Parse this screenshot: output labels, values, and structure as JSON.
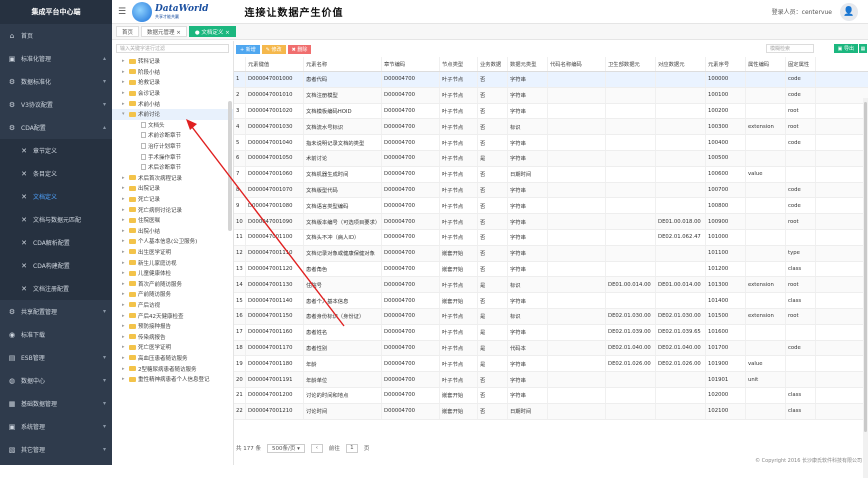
{
  "app_title": "集成平台中心端",
  "header": {
    "logo_main": "DataWorld",
    "logo_sub": "共享才能共赢",
    "slogan": "连接让数据产生价值",
    "user_label": "登录人员：centervue"
  },
  "sidebar": {
    "items": [
      {
        "label": "首页",
        "icon": "home-icon",
        "glyph": "⌂",
        "sub": false,
        "chev": ""
      },
      {
        "label": "标准化管理",
        "icon": "standard-icon",
        "glyph": "▣",
        "sub": false,
        "chev": "▴"
      },
      {
        "label": "数据标准化",
        "icon": "gear-icon",
        "glyph": "⚙",
        "sub": false,
        "chev": "▾"
      },
      {
        "label": "V3协议配置",
        "icon": "gear-icon",
        "glyph": "⚙",
        "sub": false,
        "chev": "▾"
      },
      {
        "label": "CDA配置",
        "icon": "gear-icon",
        "glyph": "⚙",
        "sub": false,
        "chev": "▴"
      },
      {
        "label": "章节定义",
        "icon": "tools-icon",
        "glyph": "✕",
        "sub": true,
        "chev": ""
      },
      {
        "label": "条目定义",
        "icon": "tools-icon",
        "glyph": "✕",
        "sub": true,
        "chev": ""
      },
      {
        "label": "文档定义",
        "icon": "tools-icon",
        "glyph": "✕",
        "sub": true,
        "chev": "",
        "active": true
      },
      {
        "label": "文档与数据元匹配",
        "icon": "tools-icon",
        "glyph": "✕",
        "sub": true,
        "chev": ""
      },
      {
        "label": "CDA解析配置",
        "icon": "tools-icon",
        "glyph": "✕",
        "sub": true,
        "chev": ""
      },
      {
        "label": "CDA构建配置",
        "icon": "tools-icon",
        "glyph": "✕",
        "sub": true,
        "chev": ""
      },
      {
        "label": "文档注册配置",
        "icon": "tools-icon",
        "glyph": "✕",
        "sub": true,
        "chev": ""
      },
      {
        "label": "共享配置管理",
        "icon": "gear-icon",
        "glyph": "⚙",
        "sub": false,
        "chev": "▾"
      },
      {
        "label": "标准下载",
        "icon": "download-icon",
        "glyph": "◉",
        "sub": false,
        "chev": ""
      },
      {
        "label": "ESB管理",
        "icon": "bus-icon",
        "glyph": "▤",
        "sub": false,
        "chev": "▾"
      },
      {
        "label": "数据中心",
        "icon": "database-icon",
        "glyph": "◍",
        "sub": false,
        "chev": "▾"
      },
      {
        "label": "基础数据管理",
        "icon": "data-icon",
        "glyph": "▦",
        "sub": false,
        "chev": "▾"
      },
      {
        "label": "系统管理",
        "icon": "system-icon",
        "glyph": "▣",
        "sub": false,
        "chev": "▾"
      },
      {
        "label": "其它管理",
        "icon": "other-icon",
        "glyph": "▧",
        "sub": false,
        "chev": "▾"
      }
    ]
  },
  "tabs": [
    {
      "label": "首页",
      "active": false
    },
    {
      "label": "数据元管理 ×",
      "active": false
    },
    {
      "label": "● 文档定义 ×",
      "active": true
    }
  ],
  "tree": {
    "search_placeholder": "输入关键字进行过滤",
    "nodes": [
      {
        "label": "转科记录",
        "depth": 1,
        "type": "folder"
      },
      {
        "label": "阶段小结",
        "depth": 1,
        "type": "folder"
      },
      {
        "label": "抢救记录",
        "depth": 1,
        "type": "folder"
      },
      {
        "label": "会诊记录",
        "depth": 1,
        "type": "folder"
      },
      {
        "label": "术前小结",
        "depth": 1,
        "type": "folder"
      },
      {
        "label": "术前讨论",
        "depth": 1,
        "type": "folder",
        "open": true
      },
      {
        "label": "文档头",
        "depth": 2,
        "type": "doc"
      },
      {
        "label": "术前诊断章节",
        "depth": 2,
        "type": "doc"
      },
      {
        "label": "治疗计划章节",
        "depth": 2,
        "type": "doc"
      },
      {
        "label": "手术操作章节",
        "depth": 2,
        "type": "doc"
      },
      {
        "label": "术后诊断章节",
        "depth": 2,
        "type": "doc"
      },
      {
        "label": "术后首次病程记录",
        "depth": 1,
        "type": "folder"
      },
      {
        "label": "出院记录",
        "depth": 1,
        "type": "folder"
      },
      {
        "label": "死亡记录",
        "depth": 1,
        "type": "folder"
      },
      {
        "label": "死亡病例讨论记录",
        "depth": 1,
        "type": "folder"
      },
      {
        "label": "住院医嘱",
        "depth": 1,
        "type": "folder"
      },
      {
        "label": "出院小结",
        "depth": 1,
        "type": "folder"
      },
      {
        "label": "个人基本信息(公卫服务)",
        "depth": 1,
        "type": "folder"
      },
      {
        "label": "出生医学证明",
        "depth": 1,
        "type": "folder"
      },
      {
        "label": "新生儿家庭访视",
        "depth": 1,
        "type": "folder"
      },
      {
        "label": "儿童健康体检",
        "depth": 1,
        "type": "folder"
      },
      {
        "label": "首次产前随访服务",
        "depth": 1,
        "type": "folder"
      },
      {
        "label": "产前随访服务",
        "depth": 1,
        "type": "folder"
      },
      {
        "label": "产后访视",
        "depth": 1,
        "type": "folder"
      },
      {
        "label": "产后42天健康检查",
        "depth": 1,
        "type": "folder"
      },
      {
        "label": "预防接种报告",
        "depth": 1,
        "type": "folder"
      },
      {
        "label": "传染病报告",
        "depth": 1,
        "type": "folder"
      },
      {
        "label": "死亡医学证明",
        "depth": 1,
        "type": "folder"
      },
      {
        "label": "高血压患者随访服务",
        "depth": 1,
        "type": "folder"
      },
      {
        "label": "2型糖尿病患者随访服务",
        "depth": 1,
        "type": "folder"
      },
      {
        "label": "重性精神病患者个人信息登记",
        "depth": 1,
        "type": "folder"
      }
    ]
  },
  "toolbar": {
    "add_label": "+ 新增",
    "edit_label": "✎ 修改",
    "delete_label": "✖ 删除",
    "search_placeholder": "模糊检索",
    "export_label": "▣ 导出"
  },
  "table": {
    "columns": [
      "",
      "元素键值",
      "元素名称",
      "章节编码",
      "节点类型",
      "业务数据",
      "数据元类型",
      "代码名称编码",
      "卫生部数据元",
      "对应数据元",
      "元素序号",
      "属性编码",
      "固定属性"
    ],
    "widths": [
      12,
      58,
      78,
      58,
      38,
      30,
      40,
      58,
      50,
      50,
      40,
      40,
      30
    ],
    "rows": [
      [
        "1",
        "D000047001000",
        "患者代码",
        "D00004700",
        "叶子节点",
        "否",
        "字符串",
        "",
        "",
        "",
        "100000",
        "",
        "code"
      ],
      [
        "2",
        "D000047001010",
        "文档注册模型",
        "D00004700",
        "叶子节点",
        "否",
        "字符串",
        "",
        "",
        "",
        "100100",
        "",
        "code"
      ],
      [
        "3",
        "D000047001020",
        "文档模板编码HOID",
        "D00004700",
        "叶子节点",
        "否",
        "字符串",
        "",
        "",
        "",
        "100200",
        "",
        "root"
      ],
      [
        "4",
        "D000047001030",
        "文档流水号标识",
        "D00004700",
        "叶子节点",
        "否",
        "标识",
        "",
        "",
        "",
        "100300",
        "extension",
        "root"
      ],
      [
        "5",
        "D000047001040",
        "指未说明记录文档的类型",
        "D00004700",
        "叶子节点",
        "否",
        "字符串",
        "",
        "",
        "",
        "100400",
        "",
        "code"
      ],
      [
        "6",
        "D000047001050",
        "术前讨论",
        "D00004700",
        "叶子节点",
        "是",
        "字符串",
        "",
        "",
        "",
        "100500",
        "",
        ""
      ],
      [
        "7",
        "D000047001060",
        "文档机器生成时间",
        "D00004700",
        "叶子节点",
        "否",
        "日期时间",
        "",
        "",
        "",
        "100600",
        "value",
        ""
      ],
      [
        "8",
        "D000047001070",
        "文档版型代码",
        "D00004700",
        "叶子节点",
        "否",
        "字符串",
        "",
        "",
        "",
        "100700",
        "",
        "code"
      ],
      [
        "9",
        "D000047001080",
        "文档语言类型编码",
        "D00004700",
        "叶子节点",
        "否",
        "字符串",
        "",
        "",
        "",
        "100800",
        "",
        "code"
      ],
      [
        "10",
        "D000047001090",
        "文档版本编号（可选项目要求）",
        "D00004700",
        "叶子节点",
        "否",
        "字符串",
        "",
        "",
        "DE01.00.018.00",
        "100900",
        "",
        "root"
      ],
      [
        "11",
        "D000047001100",
        "文档头不冲（病人ID）",
        "D00004700",
        "叶子节点",
        "否",
        "字符串",
        "",
        "",
        "DE02.01.062.47",
        "101000",
        "",
        ""
      ],
      [
        "12",
        "D000047001110",
        "文档记录对象或健康保健对象",
        "D00004700",
        "嵌套开始",
        "否",
        "字符串",
        "",
        "",
        "",
        "101100",
        "",
        "type"
      ],
      [
        "13",
        "D000047001120",
        "患者角色",
        "D00004700",
        "嵌套开始",
        "否",
        "字符串",
        "",
        "",
        "",
        "101200",
        "",
        "class"
      ],
      [
        "14",
        "D000047001130",
        "住院号",
        "D00004700",
        "叶子节点",
        "是",
        "标识",
        "",
        "DE01.00.014.00",
        "DE01.00.014.00",
        "101300",
        "extension",
        "root"
      ],
      [
        "15",
        "D000047001140",
        "患者个人基本信息",
        "D00004700",
        "嵌套开始",
        "否",
        "字符串",
        "",
        "",
        "",
        "101400",
        "",
        "class"
      ],
      [
        "16",
        "D000047001150",
        "患者身份标识（身份证）",
        "D00004700",
        "叶子节点",
        "是",
        "标识",
        "",
        "DE02.01.030.00",
        "DE02.01.030.00",
        "101500",
        "extension",
        "root"
      ],
      [
        "17",
        "D000047001160",
        "患者姓名",
        "D00004700",
        "叶子节点",
        "是",
        "字符串",
        "",
        "DE02.01.039.00",
        "DE02.01.039.65",
        "101600",
        "",
        ""
      ],
      [
        "18",
        "D000047001170",
        "患者性别",
        "D00004700",
        "叶子节点",
        "是",
        "代码本",
        "",
        "DE02.01.040.00",
        "DE02.01.040.00",
        "101700",
        "",
        "code"
      ],
      [
        "19",
        "D000047001180",
        "年龄",
        "D00004700",
        "叶子节点",
        "是",
        "字符串",
        "",
        "DE02.01.026.00",
        "DE02.01.026.00",
        "101900",
        "value",
        ""
      ],
      [
        "20",
        "D000047001191",
        "年龄单位",
        "D00004700",
        "叶子节点",
        "否",
        "字符串",
        "",
        "",
        "",
        "101901",
        "unit",
        ""
      ],
      [
        "21",
        "D000047001200",
        "讨论的时间和地点",
        "D00004700",
        "嵌套开始",
        "否",
        "字符串",
        "",
        "",
        "",
        "102000",
        "",
        "class"
      ],
      [
        "22",
        "D000047001210",
        "讨论时间",
        "D00004700",
        "嵌套开始",
        "否",
        "日期时间",
        "",
        "",
        "",
        "102100",
        "",
        "class"
      ]
    ]
  },
  "footer": {
    "total": "共 177 条",
    "page_size": "500条/页 ▾",
    "prev": "‹",
    "goto_label": "前往",
    "page": "1",
    "page_suffix": "页"
  },
  "copyright": "© Copyright 2016 长沙康氏软件科技有限公司"
}
